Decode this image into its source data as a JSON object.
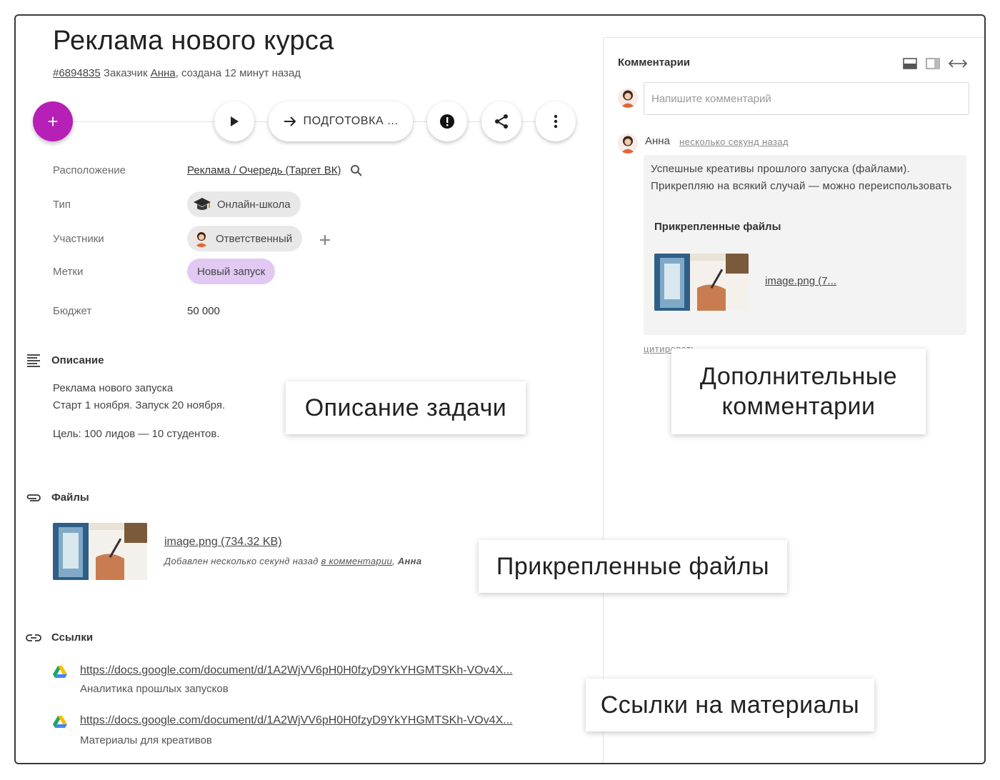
{
  "task": {
    "title": "Реклама нового курса",
    "id": "#6894835",
    "customer_label": "Заказчик",
    "customer": "Анна",
    "created": ", создана 12 минут назад"
  },
  "toolbar": {
    "add_label": "+",
    "stage_label": "ПОДГОТОВКА ..."
  },
  "properties": {
    "location_label": "Расположение",
    "location_value": "Реклама / Очередь (Таргет ВК)",
    "type_label": "Тип",
    "type_value": "Онлайн-школа",
    "members_label": "Участники",
    "members_value": "Ответственный",
    "tags_label": "Метки",
    "tags_value": "Новый запуск",
    "budget_label": "Бюджет",
    "budget_value": "50 000"
  },
  "description": {
    "heading": "Описание",
    "line1": "Реклама нового запуска",
    "line2": "Старт 1 ноября. Запуск 20 ноября.",
    "line3": "Цель: 100 лидов — 10 студентов."
  },
  "files": {
    "heading": "Файлы",
    "name": "image.png (734.32 KB)",
    "added_prefix": "Добавлен несколько секунд назад",
    "added_link": "в комментарии",
    "added_by": "Анна"
  },
  "links": {
    "heading": "Ссылки",
    "items": [
      {
        "url": "https://docs.google.com/document/d/1A2WjVV6pH0H0fzyD9YkYHGMTSKh-VOv4X...",
        "title": "Аналитика прошлых запусков"
      },
      {
        "url": "https://docs.google.com/document/d/1A2WjVV6pH0H0fzyD9YkYHGMTSKh-VOv4X...",
        "title": "Материалы для креативов"
      }
    ]
  },
  "comments": {
    "heading": "Комментарии",
    "input_placeholder": "Напишите комментарий",
    "author": "Анна",
    "time": "несколько секунд назад",
    "text": "Успешные креативы прошлого запуска (файлами). Прикрепляю на всякий случай — можно переиспользовать",
    "attached_heading": "Прикрепленные файлы",
    "attached_file": "image.png (7...",
    "quote_label": "цитировать"
  },
  "callouts": {
    "description": "Описание задачи",
    "comments_line1": "Дополнительные",
    "comments_line2": "комментарии",
    "files": "Прикрепленные файлы",
    "links": "Ссылки на материалы"
  },
  "colors": {
    "accent": "#b620b6",
    "tag_bg": "#e1c9f3",
    "chip_bg": "#e8e8e8"
  },
  "icons": [
    "plus-icon",
    "play-icon",
    "arrow-right-icon",
    "alert-icon",
    "share-icon",
    "more-vert-icon",
    "search-icon",
    "graduation-cap-icon",
    "add-person-icon",
    "notes-icon",
    "paperclip-icon",
    "link-icon",
    "google-drive-icon",
    "panel-bottom-icon",
    "panel-right-icon",
    "expand-horizontal-icon"
  ]
}
